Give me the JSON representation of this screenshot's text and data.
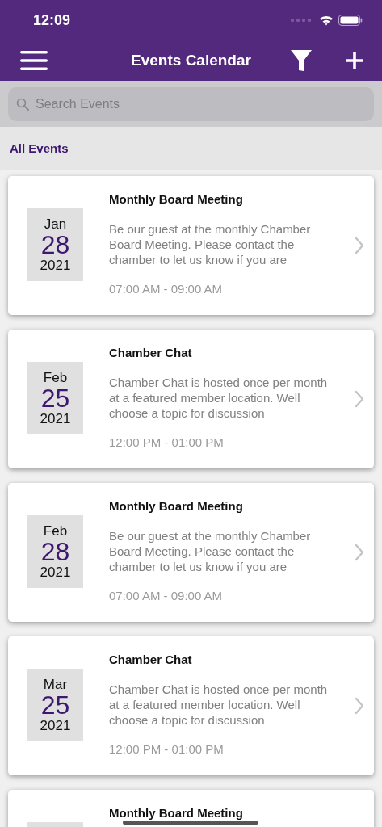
{
  "status_bar": {
    "time": "12:09"
  },
  "nav_bar": {
    "title": "Events Calendar"
  },
  "search": {
    "placeholder": "Search Events"
  },
  "section": {
    "label": "All Events"
  },
  "events": [
    {
      "month": "Jan",
      "day": "28",
      "year": "2021",
      "title": "Monthly Board Meeting",
      "description": "Be our guest at the monthly Chamber Board Meeting. Please contact the chamber to let us know if you are",
      "time": "07:00 AM - 09:00 AM"
    },
    {
      "month": "Feb",
      "day": "25",
      "year": "2021",
      "title": "Chamber Chat",
      "description": "Chamber Chat is hosted once per month at a featured member location. Well choose a topic for discussion",
      "time": "12:00 PM - 01:00 PM"
    },
    {
      "month": "Feb",
      "day": "28",
      "year": "2021",
      "title": "Monthly Board Meeting",
      "description": "Be our guest at the monthly Chamber Board Meeting. Please contact the chamber to let us know if you are",
      "time": "07:00 AM - 09:00 AM"
    },
    {
      "month": "Mar",
      "day": "25",
      "year": "2021",
      "title": "Chamber Chat",
      "description": "Chamber Chat is hosted once per month at a featured member location. Well choose a topic for discussion",
      "time": "12:00 PM - 01:00 PM"
    },
    {
      "title": "Monthly Board Meeting"
    }
  ]
}
